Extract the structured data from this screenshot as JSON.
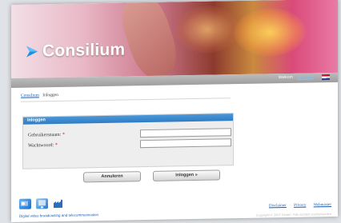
{
  "brand": {
    "name": "Consilium",
    "accent": "#1d5fb0"
  },
  "topbar": {
    "welcome_label": "Welkom",
    "user": "gebruiker",
    "flag": "nl-flag"
  },
  "breadcrumb": {
    "home": "Consilium",
    "current": "Inloggen"
  },
  "login": {
    "title": "Inloggen",
    "username_label": "Gebruikersnaam:",
    "password_label": "Wachtwoord:",
    "required_mark": "*",
    "username_value": "",
    "password_value": "",
    "cancel_label": "Annuleren",
    "submit_label": "Inloggen »"
  },
  "footer": {
    "caption": "Digital video broadcasting and telecommunication",
    "links": [
      "Disclaimer",
      "Privacy",
      "Webmaster"
    ],
    "copyright": "Copyright © 2007 Divitel - Alle rechten voorbehouden",
    "icons": [
      "satellite-icon",
      "monitor-icon",
      "factory-icon"
    ]
  }
}
